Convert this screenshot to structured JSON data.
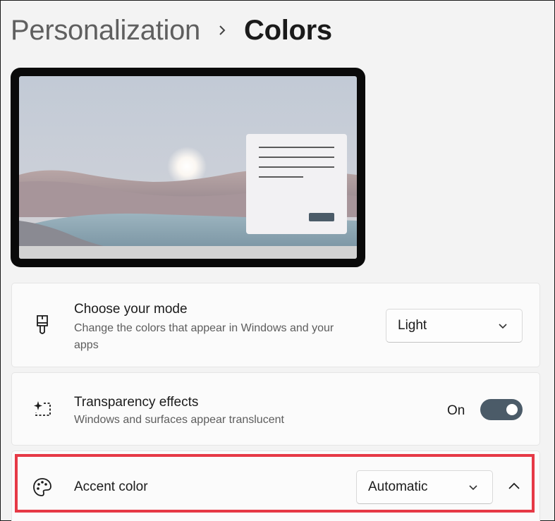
{
  "breadcrumb": {
    "parent": "Personalization",
    "separator_icon": "chevron-right-icon",
    "current": "Colors"
  },
  "colors": {
    "accent_dark": "#4b5b68",
    "highlight": "#e63946",
    "background": "#f3f3f3",
    "card": "#fbfbfb"
  },
  "settings": {
    "mode": {
      "icon": "paintbrush-icon",
      "title": "Choose your mode",
      "description": "Change the colors that appear in Windows and your apps",
      "value": "Light"
    },
    "transparency": {
      "icon": "transparency-sparkle-icon",
      "title": "Transparency effects",
      "description": "Windows and surfaces appear translucent",
      "state": "On"
    },
    "accent": {
      "icon": "palette-icon",
      "title": "Accent color",
      "value": "Automatic",
      "expand_icon": "chevron-up-icon"
    }
  }
}
